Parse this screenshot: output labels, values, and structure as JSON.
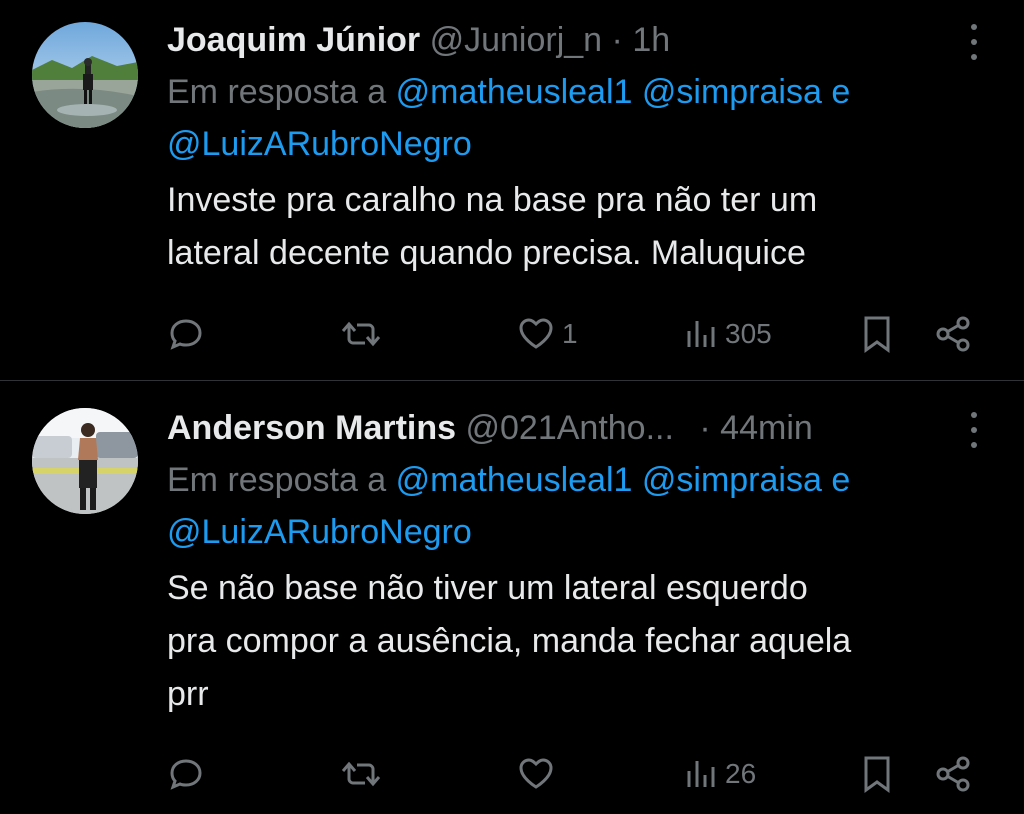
{
  "tweets": [
    {
      "name": "Joaquim Júnior",
      "handle": "@Juniorj_n",
      "separator": "·",
      "time": "1h",
      "reply_prefix": "Em resposta a",
      "mentions_line1": "@matheusleal1 @simpraisa e",
      "mentions_line2": "@LuizARubroNegro",
      "text_lines": [
        "Investe pra caralho na base pra não ter um",
        "lateral decente quando precisa. Maluquice"
      ],
      "likes": "1",
      "views": "305"
    },
    {
      "name": "Anderson Martins",
      "handle": "@021Antho...",
      "separator": "·",
      "time": "44min",
      "reply_prefix": "Em resposta a",
      "mentions_line1": "@matheusleal1 @simpraisa e",
      "mentions_line2": "@LuizARubroNegro",
      "text_lines": [
        "Se não base não tiver um lateral esquerdo",
        "pra compor a ausência, manda fechar aquela",
        "prr"
      ],
      "likes": "",
      "views": "26"
    }
  ],
  "icons": {
    "reply": "reply-icon",
    "retweet": "retweet-icon",
    "like": "heart-icon",
    "views": "views-chart-icon",
    "bookmark": "bookmark-icon",
    "share": "share-icon",
    "more": "more-vertical-icon"
  },
  "colors": {
    "background": "#000000",
    "text": "#e7e9ea",
    "muted": "#71767b",
    "link": "#1d9bf0"
  }
}
